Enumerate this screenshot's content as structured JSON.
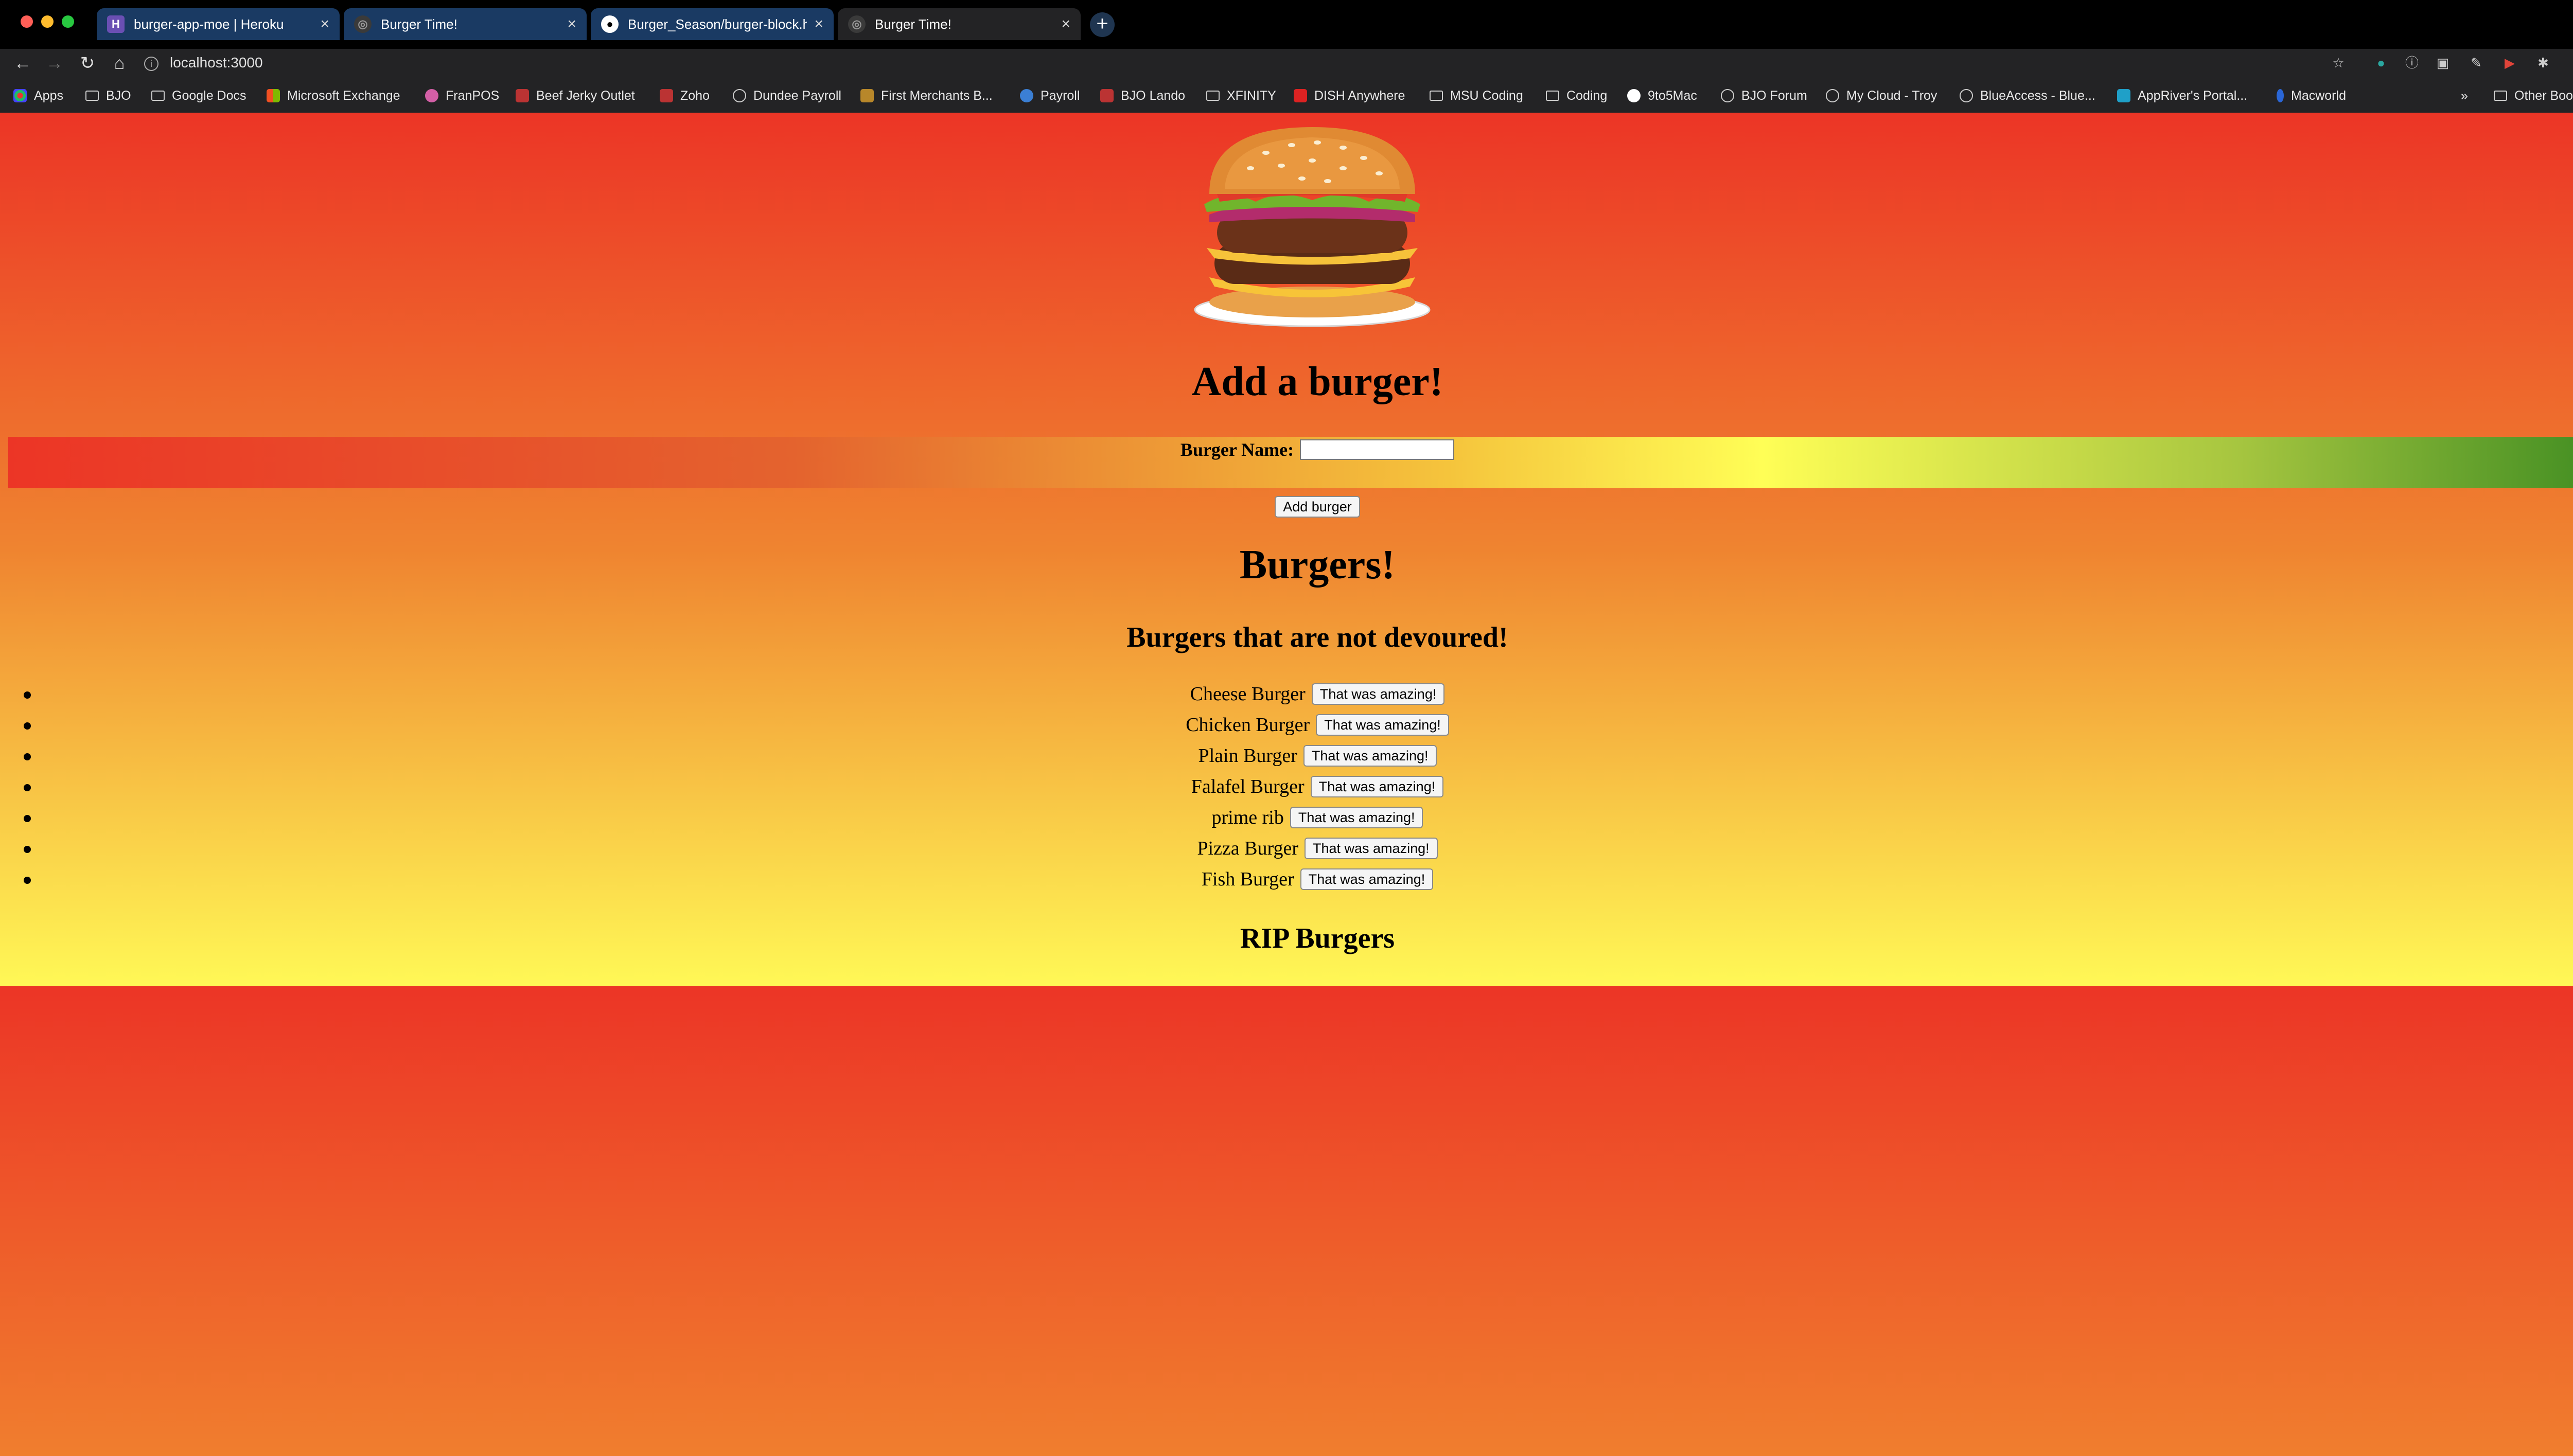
{
  "browser": {
    "tabs": [
      {
        "title": "burger-app-moe | Heroku",
        "favicon": "heroku-icon"
      },
      {
        "title": "Burger Time!",
        "favicon": "globe-icon"
      },
      {
        "title": "Burger_Season/burger-block.ht",
        "favicon": "github-icon"
      },
      {
        "title": "Burger Time!",
        "favicon": "globe-icon"
      }
    ],
    "active_tab": 3,
    "url": "localhost:3000",
    "bookmarks": [
      "Apps",
      "BJO",
      "Google Docs",
      "Microsoft Exchange",
      "FranPOS",
      "Beef Jerky Outlet",
      "Zoho",
      "Dundee Payroll",
      "First Merchants B...",
      "Payroll",
      "BJO Lando",
      "XFINITY",
      "DISH Anywhere",
      "MSU Coding",
      "Coding",
      "9to5Mac",
      "BJO Forum",
      "My Cloud - Troy",
      "BlueAccess - Blue...",
      "AppRiver's Portal...",
      "Macworld"
    ],
    "other_bookmarks": "Other Bookmarks",
    "overflow": "»"
  },
  "page": {
    "add_heading": "Add a burger!",
    "form_label": "Burger Name:",
    "form_value": "",
    "submit_label": "Add burger",
    "burgers_heading": "Burgers!",
    "not_devoured_heading": "Burgers that are not devoured!",
    "rip_heading": "RIP Burgers",
    "devour_label": "That was amazing!",
    "burgers": [
      "Cheese Burger",
      "Chicken Burger",
      "Plain Burger",
      "Falafel Burger",
      "prime rib",
      "Pizza Burger",
      "Fish Burger"
    ]
  }
}
